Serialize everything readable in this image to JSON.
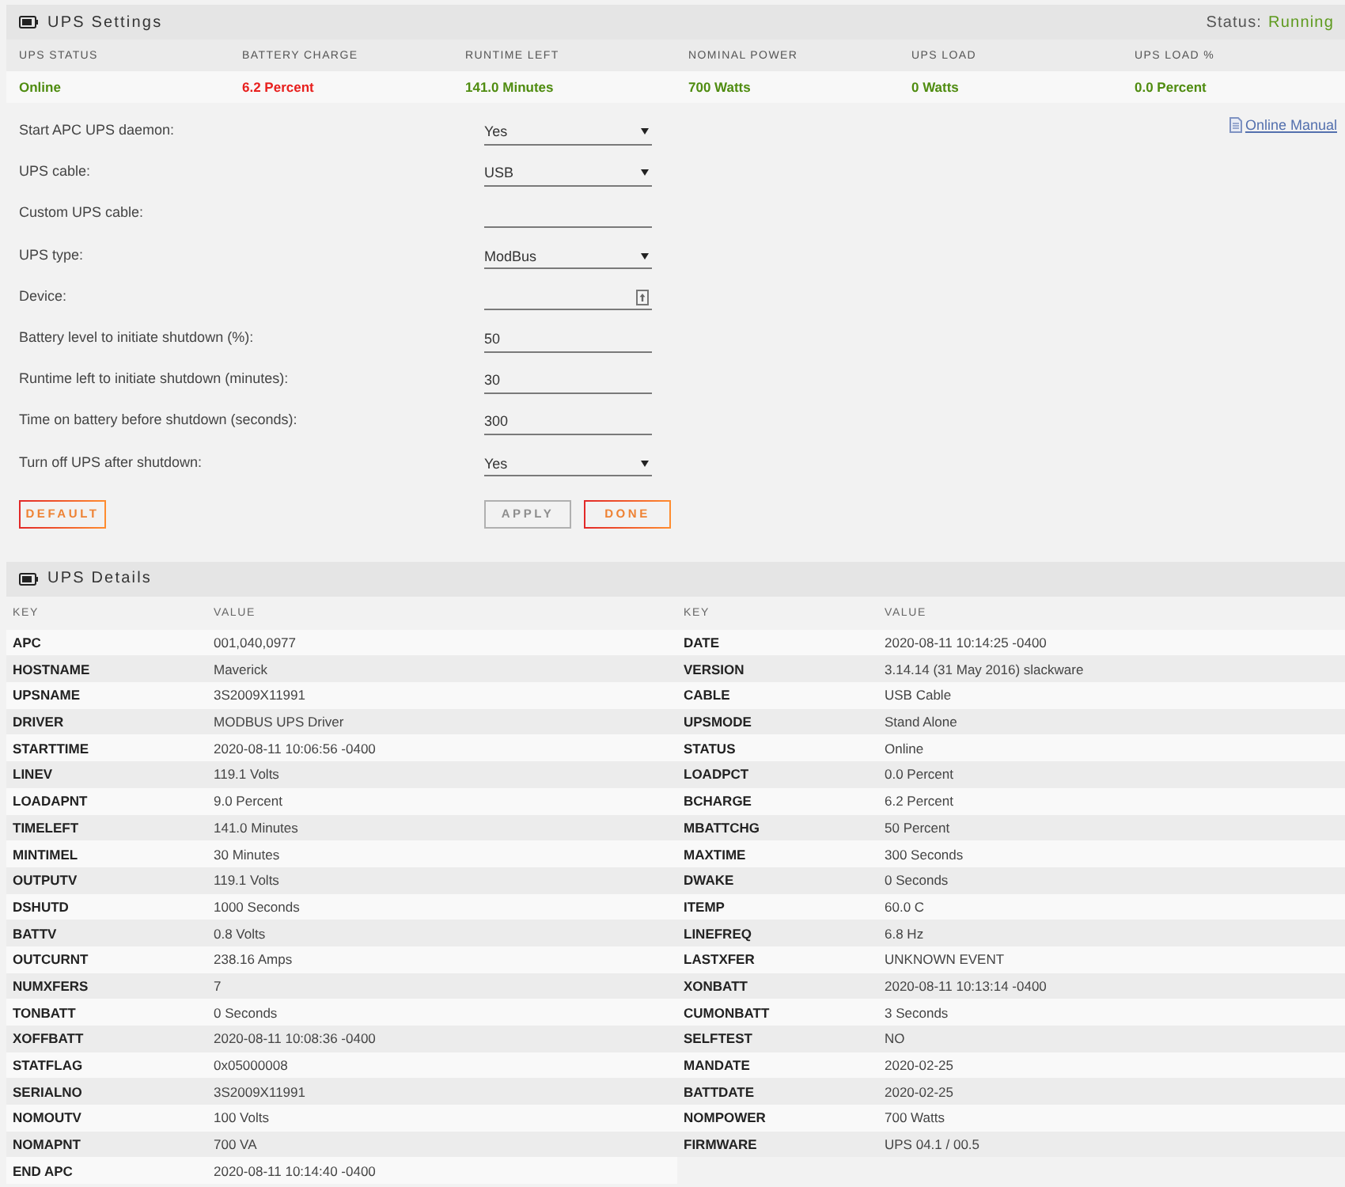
{
  "settings": {
    "title": "UPS Settings",
    "status_label": "Status:",
    "status_value": "Running"
  },
  "summary": [
    {
      "heading": "UPS STATUS",
      "value": "Online",
      "color": "#4f8c10"
    },
    {
      "heading": "BATTERY CHARGE",
      "value": "6.2 Percent",
      "color": "#e8201e"
    },
    {
      "heading": "RUNTIME LEFT",
      "value": "141.0 Minutes",
      "color": "#4f8c10"
    },
    {
      "heading": "NOMINAL POWER",
      "value": "700 Watts",
      "color": "#4f8c10"
    },
    {
      "heading": "UPS LOAD",
      "value": "0 Watts",
      "color": "#4f8c10"
    },
    {
      "heading": "UPS LOAD %",
      "value": "0.0 Percent",
      "color": "#4f8c10"
    }
  ],
  "manual_link": {
    "label": "Online Manual"
  },
  "form": {
    "fields": [
      {
        "label": "Start APC UPS daemon:",
        "kind": "select",
        "value": "Yes"
      },
      {
        "label": "UPS cable:",
        "kind": "select",
        "value": "USB"
      },
      {
        "label": "Custom UPS cable:",
        "kind": "text"
      },
      {
        "label": "UPS type:",
        "kind": "select",
        "value": "ModBus"
      },
      {
        "label": "Device:",
        "kind": "picker"
      },
      {
        "label": "Battery level to initiate shutdown (%):",
        "kind": "number",
        "value": "50"
      },
      {
        "label": "Runtime left to initiate shutdown (minutes):",
        "kind": "number",
        "value": "30"
      },
      {
        "label": "Time on battery before shutdown (seconds):",
        "kind": "number",
        "value": "300"
      },
      {
        "label": "Turn off UPS after shutdown:",
        "kind": "select",
        "value": "Yes"
      }
    ],
    "buttons": [
      {
        "label": "DEFAULT",
        "kind": "reset",
        "disabled": false
      },
      {
        "label": "APPLY",
        "kind": "submit",
        "disabled": true
      },
      {
        "label": "DONE",
        "kind": "submit",
        "disabled": false
      }
    ]
  },
  "details": {
    "title": "UPS Details",
    "tables": [
      {
        "columns": [
          "KEY",
          "VALUE"
        ],
        "rows": [
          {
            "key": "APC",
            "value": "001,040,0977"
          },
          {
            "key": "HOSTNAME",
            "value": "Maverick"
          },
          {
            "key": "UPSNAME",
            "value": "3S2009X11991"
          },
          {
            "key": "DRIVER",
            "value": "MODBUS UPS Driver"
          },
          {
            "key": "STARTTIME",
            "value": "2020-08-11 10:06:56 -0400"
          },
          {
            "key": "LINEV",
            "value": "119.1 Volts"
          },
          {
            "key": "LOADAPNT",
            "value": "9.0 Percent"
          },
          {
            "key": "TIMELEFT",
            "value": "141.0 Minutes"
          },
          {
            "key": "MINTIMEL",
            "value": "30 Minutes"
          },
          {
            "key": "OUTPUTV",
            "value": "119.1 Volts"
          },
          {
            "key": "DSHUTD",
            "value": "1000 Seconds"
          },
          {
            "key": "BATTV",
            "value": "0.8 Volts"
          },
          {
            "key": "OUTCURNT",
            "value": "238.16 Amps"
          },
          {
            "key": "NUMXFERS",
            "value": "7"
          },
          {
            "key": "TONBATT",
            "value": "0 Seconds"
          },
          {
            "key": "XOFFBATT",
            "value": "2020-08-11 10:08:36 -0400"
          },
          {
            "key": "STATFLAG",
            "value": "0x05000008"
          },
          {
            "key": "SERIALNO",
            "value": "3S2009X11991"
          },
          {
            "key": "NOMOUTV",
            "value": "100 Volts"
          },
          {
            "key": "NOMAPNT",
            "value": "700 VA"
          },
          {
            "key": "END APC",
            "value": "2020-08-11 10:14:40 -0400"
          }
        ]
      },
      {
        "columns": [
          "KEY",
          "VALUE"
        ],
        "rows": [
          {
            "key": "DATE",
            "value": "2020-08-11 10:14:25 -0400"
          },
          {
            "key": "VERSION",
            "value": "3.14.14 (31 May 2016) slackware"
          },
          {
            "key": "CABLE",
            "value": "USB Cable"
          },
          {
            "key": "UPSMODE",
            "value": "Stand Alone"
          },
          {
            "key": "STATUS",
            "value": "Online"
          },
          {
            "key": "LOADPCT",
            "value": "0.0 Percent"
          },
          {
            "key": "BCHARGE",
            "value": "6.2 Percent"
          },
          {
            "key": "MBATTCHG",
            "value": "50 Percent"
          },
          {
            "key": "MAXTIME",
            "value": "300 Seconds"
          },
          {
            "key": "DWAKE",
            "value": "0 Seconds"
          },
          {
            "key": "ITEMP",
            "value": "60.0 C"
          },
          {
            "key": "LINEFREQ",
            "value": "6.8 Hz"
          },
          {
            "key": "LASTXFER",
            "value": "UNKNOWN EVENT"
          },
          {
            "key": "XONBATT",
            "value": "2020-08-11 10:13:14 -0400"
          },
          {
            "key": "CUMONBATT",
            "value": "3 Seconds"
          },
          {
            "key": "SELFTEST",
            "value": "NO"
          },
          {
            "key": "MANDATE",
            "value": "2020-02-25"
          },
          {
            "key": "BATTDATE",
            "value": "2020-02-25"
          },
          {
            "key": "NOMPOWER",
            "value": "700 Watts"
          },
          {
            "key": "FIRMWARE",
            "value": "UPS 04.1 / 00.5"
          }
        ]
      }
    ]
  }
}
